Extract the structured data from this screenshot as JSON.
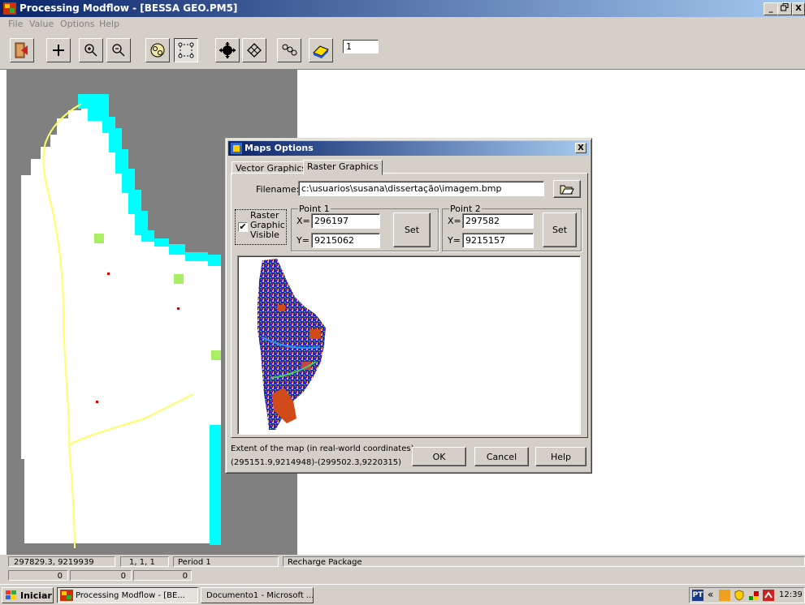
{
  "window": {
    "title": "Processing Modflow - [BESSA GEO.PM5]",
    "controls": [
      "_",
      " ",
      "X"
    ]
  },
  "menu": [
    "File",
    "Value",
    "Options",
    "Help"
  ],
  "toolbar": {
    "buttons": [
      "exit-icon",
      "add-icon",
      "zoom-in-icon",
      "zoom-out-icon",
      "digitize-icon",
      "polygon-icon",
      "move-icon",
      "grid-icon",
      "particle-icon",
      "layer-icon"
    ],
    "layer_value": "1"
  },
  "dialog": {
    "title": "Maps Options",
    "close": "X",
    "tabs": [
      "Vector Graphics",
      "Raster Graphics"
    ],
    "active_tab": "Raster Graphics",
    "filename_label": "Filename:",
    "filename_value": "c:\\usuarios\\susana\\dissertação\\imagem.bmp",
    "checkbox_checked": true,
    "checkbox_label_1": "Raster",
    "checkbox_label_2": "Graphic",
    "checkbox_label_3": "Visible",
    "point1": {
      "title": "Point 1",
      "x_label": "X=",
      "x_value": "296197",
      "y_label": "Y=",
      "y_value": "9215062",
      "set": "Set"
    },
    "point2": {
      "title": "Point 2",
      "x_label": "X=",
      "x_value": "297582",
      "y_label": "Y=",
      "y_value": "9215157",
      "set": "Set"
    },
    "extent_label": "Extent of the map (in real-world coordinates):",
    "extent_value": "(295151.9,9214948)-(299502.3,9220315)",
    "ok": "OK",
    "cancel": "Cancel",
    "help": "Help"
  },
  "status": {
    "coords": "297829.3,  9219939",
    "cell": "1, 1, 1",
    "period": "Period 1",
    "package": "Recharge Package",
    "row2_a": "0",
    "row2_b": "0",
    "row2_c": "0"
  },
  "taskbar": {
    "start": "Iniciar",
    "items": [
      "Processing Modflow - [BE...",
      "Documento1 - Microsoft ..."
    ],
    "lang": "PT",
    "clock": "12:39",
    "chevron": "«"
  },
  "colors": {
    "titlebar_start": "#0a246a",
    "titlebar_end": "#a6caf0",
    "face": "#d4d0c8",
    "cyan_cells": "#00ffff",
    "green_cells": "#aaee66",
    "boundary_line": "#ffff66",
    "map_blue": "#2a1fd0",
    "map_orange": "#d04a1a"
  }
}
